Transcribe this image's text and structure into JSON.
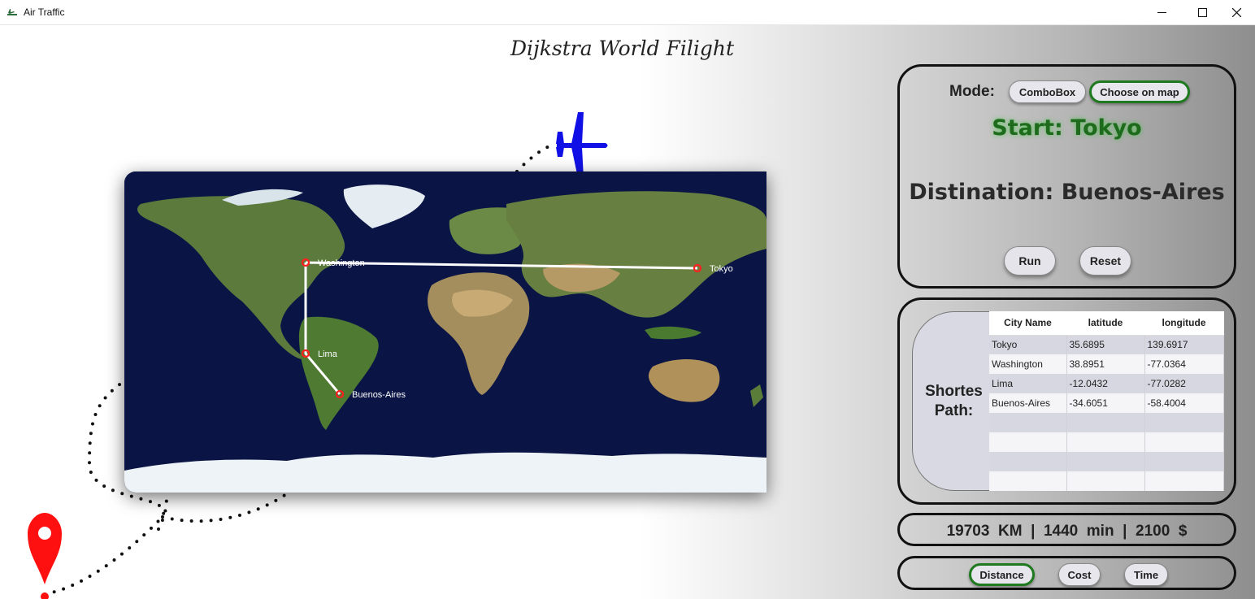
{
  "window": {
    "title": "Air Traffic",
    "minimize_icon": "minimize-icon",
    "maximize_icon": "maximize-icon",
    "close_icon": "close-icon"
  },
  "app": {
    "heading": "Dijkstra World Filight"
  },
  "map": {
    "cities": [
      {
        "name": "Washington"
      },
      {
        "name": "Tokyo"
      },
      {
        "name": "Lima"
      },
      {
        "name": "Buenos-Aires"
      }
    ],
    "route_color": "#ffffff",
    "city_marker_color": "#ff2020"
  },
  "decor": {
    "plane_color": "#1010e6",
    "pin_color": "#ff1010"
  },
  "mode": {
    "label": "Mode:",
    "options": [
      {
        "label": "ComboBox",
        "active": false
      },
      {
        "label": "Choose on map",
        "active": true
      }
    ],
    "start_text": "Start: Tokyo",
    "destination_text": "Distination: Buenos-Aires",
    "run_label": "Run",
    "reset_label": "Reset"
  },
  "shortest_path": {
    "label_line1": "Shortes",
    "label_line2": "Path:",
    "columns": [
      "City Name",
      "latitude",
      "longitude"
    ],
    "rows": [
      [
        "Tokyo",
        "35.6895",
        "139.6917"
      ],
      [
        "Washington",
        "38.8951",
        "-77.0364"
      ],
      [
        "Lima",
        "-12.0432",
        "-77.0282"
      ],
      [
        "Buenos-Aires",
        "-34.6051",
        "-58.4004"
      ],
      [
        "",
        "",
        ""
      ],
      [
        "",
        "",
        ""
      ],
      [
        "",
        "",
        ""
      ],
      [
        "",
        "",
        ""
      ]
    ]
  },
  "totals": {
    "text": "19703  KM  |  1440  min  |  2100  $"
  },
  "criteria": {
    "options": [
      {
        "label": "Distance",
        "active": true
      },
      {
        "label": "Cost",
        "active": false
      },
      {
        "label": "Time",
        "active": false
      }
    ],
    "active_border_color": "#1f7a1f"
  }
}
